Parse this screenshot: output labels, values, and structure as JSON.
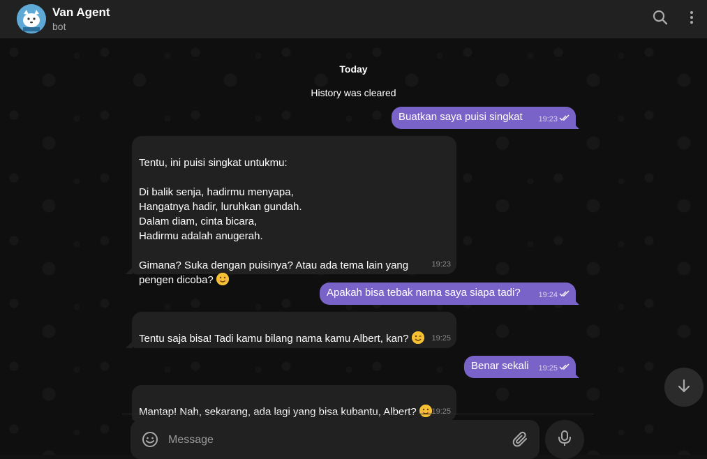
{
  "header": {
    "title": "Van Agent",
    "subtitle": "bot"
  },
  "chat": {
    "date_label": "Today",
    "service_message": "History was cleared",
    "messages": [
      {
        "direction": "out",
        "text": "Buatkan saya puisi singkat",
        "time": "19:23",
        "status": "read"
      },
      {
        "direction": "in",
        "text": "Tentu, ini puisi singkat untukmu:\n\nDi balik senja, hadirmu menyapa,\nHangatnya hadir, luruhkan gundah.\nDalam diam, cinta bicara,\nHadirmu adalah anugerah.\n\nGimana? Suka dengan puisinya? Atau ada tema lain yang\npengen dicoba?",
        "emoji": "smiling-face-emoji",
        "time": "19:23"
      },
      {
        "direction": "out",
        "text": "Apakah bisa tebak nama saya siapa tadi?",
        "time": "19:24",
        "status": "read"
      },
      {
        "direction": "in",
        "text": "Tentu saja bisa! Tadi kamu bilang nama kamu Albert, kan?",
        "emoji": "winking-face-emoji",
        "time": "19:25"
      },
      {
        "direction": "out",
        "text": "Benar sekali",
        "time": "19:25",
        "status": "read"
      },
      {
        "direction": "in",
        "text": "Mantap! Nah, sekarang, ada lagi yang bisa kubantu, Albert?",
        "emoji": "smiling-face-emoji",
        "time": "19:25"
      }
    ]
  },
  "composer": {
    "placeholder": "Message"
  },
  "icons": {
    "search": "search-icon",
    "menu": "more-vertical-icon",
    "emoji": "emoji-icon",
    "attach": "paperclip-icon",
    "mic": "microphone-icon",
    "scroll": "arrow-down-icon"
  },
  "colors": {
    "outgoing_bubble": "#7a63c8",
    "incoming_bubble": "#212121",
    "header": "#212121",
    "background": "#0f0f0f"
  }
}
